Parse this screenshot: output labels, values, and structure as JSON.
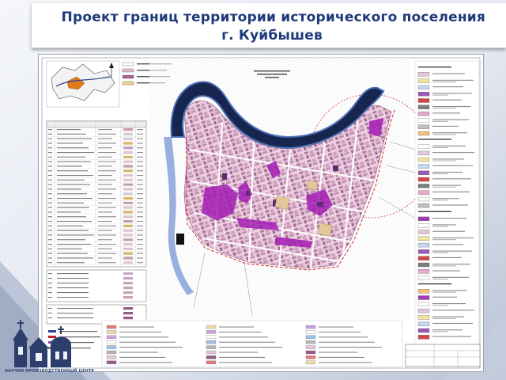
{
  "slide": {
    "title_line1": "Проект границ территории исторического поселения",
    "title_line2": "г. Куйбышев",
    "colors": {
      "title": "#1f3a7a",
      "background_gradient_light": "#eef1f6",
      "background_gradient_dark": "#b9c3d6",
      "river": "#1a2a5c",
      "river_bank": "#4f6fb8",
      "block_fill": "#e9c6dc",
      "protected_zone": "#a01ab0",
      "historic_boundary": "#d81b1b"
    }
  },
  "map": {
    "sheet_icons": [
      "north-arrow-icon",
      "location-inset-map",
      "legend-panel",
      "stamp-table"
    ]
  },
  "logo": {
    "caption": "НАУЧНО-ПРОИЗВОДСТВЕННЫЙ ЦЕНТР",
    "icon": "church-logo-icon"
  }
}
